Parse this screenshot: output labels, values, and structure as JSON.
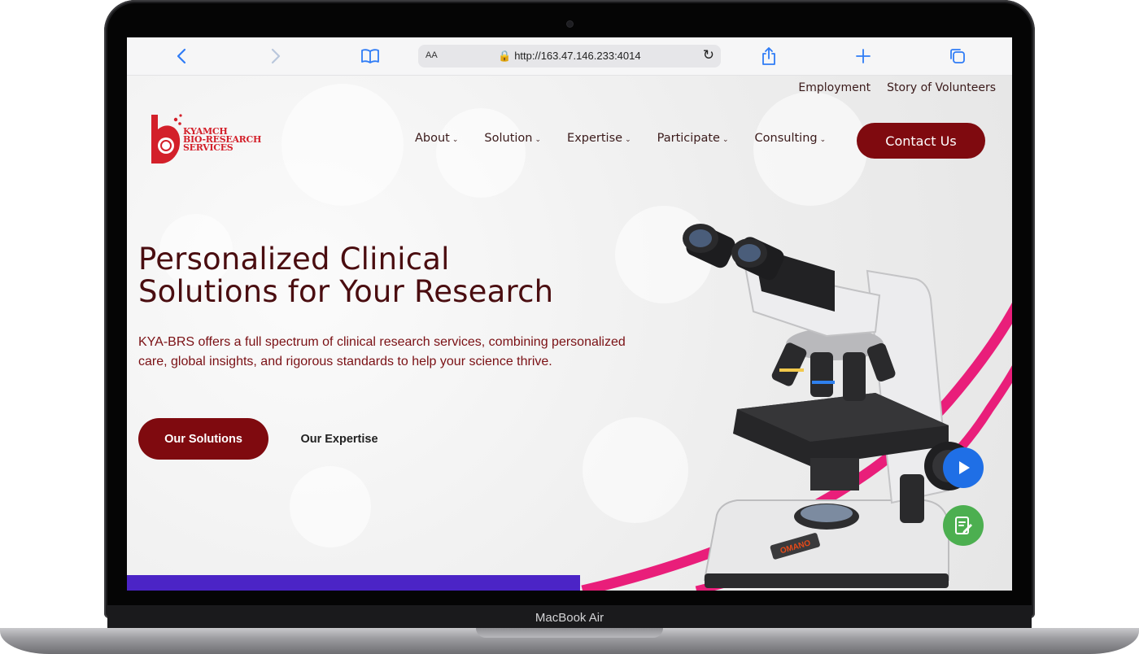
{
  "device": {
    "model_label": "MacBook Air"
  },
  "browser": {
    "address": {
      "text_size_label": "AA",
      "url": "http://163.47.146.233:4014"
    }
  },
  "site": {
    "top_links": [
      "Employment",
      "Story of Volunteers"
    ],
    "logo": {
      "line1": "KYAMCH",
      "line2": "BIO-RESEARCH",
      "line3": "SERVICES"
    },
    "nav": [
      {
        "label": "About"
      },
      {
        "label": "Solution"
      },
      {
        "label": "Expertise"
      },
      {
        "label": "Participate"
      },
      {
        "label": "Consulting"
      }
    ],
    "contact_label": "Contact Us",
    "hero": {
      "title_line1": "Personalized Clinical",
      "title_line2": "Solutions for Your Research",
      "description": "KYA-BRS offers a full spectrum of clinical research services, combining personalized care, global insights, and rigorous standards to help your science thrive.",
      "primary_button": "Our Solutions",
      "secondary_button": "Our Expertise"
    },
    "microscope_brand": "OMANO",
    "colors": {
      "brand": "#7f0a0f",
      "accent_pink": "#e91e7a",
      "accent_purple": "#4b24c6",
      "play_fab": "#1f6fe6",
      "note_fab": "#4caf50"
    }
  }
}
